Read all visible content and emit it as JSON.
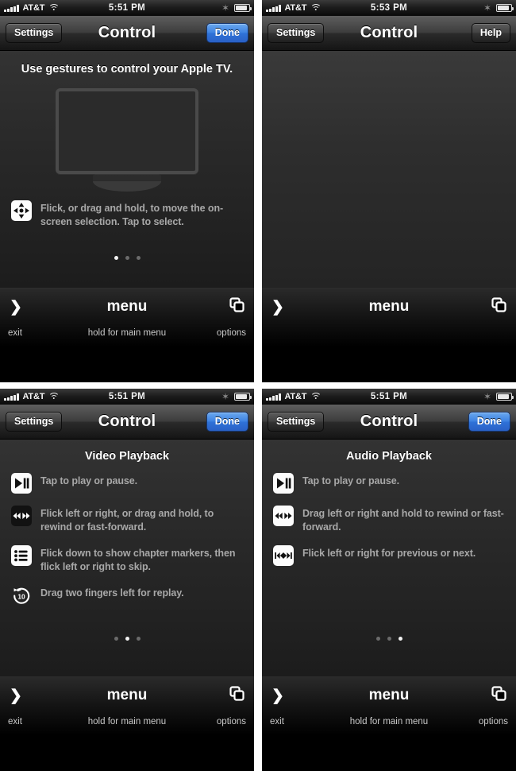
{
  "statusbar": {
    "carrier": "AT&T",
    "time_a": "5:51 PM",
    "time_b": "5:53 PM",
    "bluetooth_icon": "bluetooth-icon",
    "battery_icon": "battery-icon",
    "wifi_icon": "wifi-icon",
    "signal_icon": "signal-bars-icon"
  },
  "nav": {
    "settings_label": "Settings",
    "title": "Control",
    "done_label": "Done",
    "help_label": "Help"
  },
  "bottom": {
    "menu_label": "menu",
    "exit_label": "exit",
    "hold_label": "hold for main menu",
    "options_label": "options",
    "exit_icon": "chevron-right-icon",
    "options_icon": "overlapping-squares-icon"
  },
  "colors": {
    "accent_blue": "#3e82e2",
    "body_dark": "#2a2a2a",
    "text_dim": "#a8a8a8"
  },
  "panels": [
    {
      "id": "panel-gestures",
      "time": "5:51 PM",
      "right_button": "Done",
      "right_button_style": "blue",
      "headline": "Use gestures to control your Apple TV.",
      "illustration": "apple-tv-screen-illustration",
      "tips": [
        {
          "icon": "dpad-icon",
          "icon_style": "white",
          "text": "Flick, or drag and hold, to move the on-screen selection.  Tap to select."
        }
      ],
      "dots": {
        "count": 3,
        "active": 0
      },
      "bottom_labels": true
    },
    {
      "id": "panel-blank",
      "time": "5:53 PM",
      "right_button": "Help",
      "right_button_style": "gray",
      "headline": "",
      "illustration": "",
      "tips": [],
      "dots": {
        "count": 0,
        "active": -1
      },
      "bottom_labels": false
    },
    {
      "id": "panel-video-playback",
      "time": "5:51 PM",
      "right_button": "Done",
      "right_button_style": "blue",
      "headline": "Video Playback",
      "illustration": "",
      "tips": [
        {
          "icon": "play-pause-icon",
          "icon_style": "white",
          "text": "Tap to play or pause."
        },
        {
          "icon": "rewind-fast-forward-icon",
          "icon_style": "dark",
          "text": "Flick left or right, or drag and hold, to rewind or fast-forward."
        },
        {
          "icon": "chapter-list-icon",
          "icon_style": "white",
          "text": "Flick down to show chapter markers, then flick left or right to skip."
        },
        {
          "icon": "replay-10-icon",
          "icon_style": "plain",
          "text": "Drag two fingers left for replay.",
          "badge": "10"
        }
      ],
      "dots": {
        "count": 3,
        "active": 1
      },
      "bottom_labels": true
    },
    {
      "id": "panel-audio-playback",
      "time": "5:51 PM",
      "right_button": "Done",
      "right_button_style": "blue",
      "headline": "Audio Playback",
      "illustration": "",
      "tips": [
        {
          "icon": "play-pause-icon",
          "icon_style": "white",
          "text": "Tap to play or pause."
        },
        {
          "icon": "rewind-fast-forward-icon",
          "icon_style": "white",
          "text": "Drag left or right and hold to rewind or fast-forward."
        },
        {
          "icon": "previous-next-icon",
          "icon_style": "white",
          "text": "Flick left or right for previous or next."
        }
      ],
      "dots": {
        "count": 3,
        "active": 2
      },
      "bottom_labels": true
    }
  ]
}
